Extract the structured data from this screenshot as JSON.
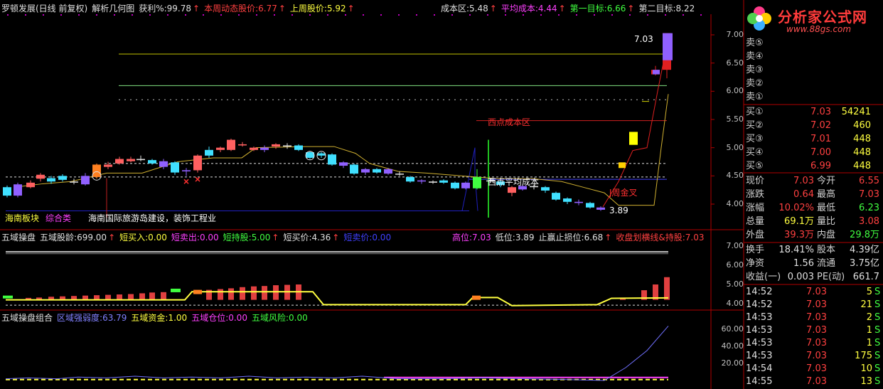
{
  "main_header": {
    "title": "罗顿发展(日线 前复权)",
    "indicator": "解析几何图",
    "profit_label": "获利%:",
    "profit_value": "99.78",
    "weekly_dyn_label": "本周动态股价:",
    "weekly_dyn_value": "6.77",
    "last_week_label": "上周股价:",
    "last_week_value": "5.92",
    "cost_zone_label": "成本区:",
    "cost_zone_value": "5.48",
    "avg_cost_label": "平均成本:",
    "avg_cost_value": "4.44",
    "target1_label": "第一目标:",
    "target1_value": "6.66",
    "target2_label": "第二目标:",
    "target2_value": "8.22"
  },
  "logo": {
    "brand": "分析家公式网",
    "url": "www.88gs.com"
  },
  "main_chart": {
    "left_tags": {
      "sector": "海南板块",
      "category": "综合类",
      "concept": "海南国际旅游岛建设，装饰工程业"
    },
    "annotations": {
      "west_cost": "西点成本区",
      "east_avg": "西点平均成本",
      "j_cross": "J周金叉",
      "high_label": "7.03",
      "low_label": "3.89"
    },
    "y_ticks": [
      "7.00",
      "6.50",
      "6.00",
      "5.50",
      "5.00",
      "4.50",
      "4.00"
    ]
  },
  "panel2_header": {
    "name": "五域操盘",
    "age_label": "五域股龄:",
    "age_value": "699.00",
    "short_buy_label": "短买入:",
    "short_buy_value": "0.00",
    "short_sell_label": "短卖出:",
    "short_sell_value": "0.00",
    "short_hold_label": "短持股:",
    "short_hold_value": "5.00",
    "short_price_label": "短买价:",
    "short_price_value": "4.36",
    "short_sell_price_label": "短卖价:",
    "short_sell_price_value": "0.00",
    "high_label": "高位:",
    "high_value": "7.03",
    "low_label": "低位:",
    "low_value": "3.89",
    "stop_label": "止赢止损位:",
    "stop_value": "6.68",
    "close_label": "收盘划横线&持股:",
    "close_value": "7.03"
  },
  "panel2": {
    "y_ticks": [
      "7.00",
      "6.00",
      "5.00",
      "4.00"
    ]
  },
  "panel3_header": {
    "name": "五域操盘组合",
    "strength_label": "区域强弱度:",
    "strength_value": "63.79",
    "fund_label": "五域资金:",
    "fund_value": "1.00",
    "position_label": "五域仓位:",
    "position_value": "0.00",
    "risk_label": "五域风险:",
    "risk_value": "0.00"
  },
  "panel3": {
    "y_ticks": [
      "60.00",
      "40.00",
      "20.00"
    ]
  },
  "order_book": {
    "sell": [
      {
        "label": "卖⑤",
        "price": "",
        "vol": ""
      },
      {
        "label": "卖④",
        "price": "",
        "vol": ""
      },
      {
        "label": "卖③",
        "price": "",
        "vol": ""
      },
      {
        "label": "卖②",
        "price": "",
        "vol": ""
      },
      {
        "label": "卖①",
        "price": "",
        "vol": ""
      }
    ],
    "buy": [
      {
        "label": "买①",
        "price": "7.03",
        "vol": "54241"
      },
      {
        "label": "买②",
        "price": "7.02",
        "vol": "460"
      },
      {
        "label": "买③",
        "price": "7.01",
        "vol": "448"
      },
      {
        "label": "买④",
        "price": "7.00",
        "vol": "448"
      },
      {
        "label": "买⑤",
        "price": "6.99",
        "vol": "448"
      }
    ]
  },
  "quote": [
    {
      "l1": "现价",
      "v1": "7.03",
      "c1": "#ff4040",
      "l2": "今开",
      "v2": "6.55",
      "c2": "#ff4040"
    },
    {
      "l1": "涨跌",
      "v1": "0.64",
      "c1": "#ff4040",
      "l2": "最高",
      "v2": "7.03",
      "c2": "#ff4040"
    },
    {
      "l1": "涨幅",
      "v1": "10.02%",
      "c1": "#ff4040",
      "l2": "最低",
      "v2": "6.23",
      "c2": "#40ff40"
    },
    {
      "l1": "总量",
      "v1": "69.1万",
      "c1": "#ffff40",
      "l2": "量比",
      "v2": "3.08",
      "c2": "#ff4040"
    },
    {
      "l1": "外盘",
      "v1": "39.3万",
      "c1": "#ff4040",
      "l2": "内盘",
      "v2": "29.8万",
      "c2": "#40ff40"
    },
    {
      "l1": "换手",
      "v1": "18.41%",
      "c1": "#e0e0e0",
      "l2": "股本",
      "v2": "4.39亿",
      "c2": "#e0e0e0"
    },
    {
      "l1": "净资",
      "v1": "1.56",
      "c1": "#e0e0e0",
      "l2": "流通",
      "v2": "3.75亿",
      "c2": "#e0e0e0"
    },
    {
      "l1": "收益(一)",
      "v1": "0.003",
      "c1": "#e0e0e0",
      "l2": "PE(动)",
      "v2": "661.7",
      "c2": "#e0e0e0"
    }
  ],
  "ticks": [
    {
      "time": "14:52",
      "price": "7.03",
      "vol": "5",
      "side": "S"
    },
    {
      "time": "14:52",
      "price": "7.03",
      "vol": "21",
      "side": "S"
    },
    {
      "time": "14:53",
      "price": "7.03",
      "vol": "2",
      "side": "S"
    },
    {
      "time": "14:53",
      "price": "7.03",
      "vol": "1",
      "side": "S"
    },
    {
      "time": "14:53",
      "price": "7.03",
      "vol": "1",
      "side": "S"
    },
    {
      "time": "14:53",
      "price": "7.03",
      "vol": "175",
      "side": "S"
    },
    {
      "time": "14:54",
      "price": "7.03",
      "vol": "10",
      "side": "S"
    },
    {
      "time": "14:55",
      "price": "7.03",
      "vol": "13",
      "side": "S"
    }
  ]
}
